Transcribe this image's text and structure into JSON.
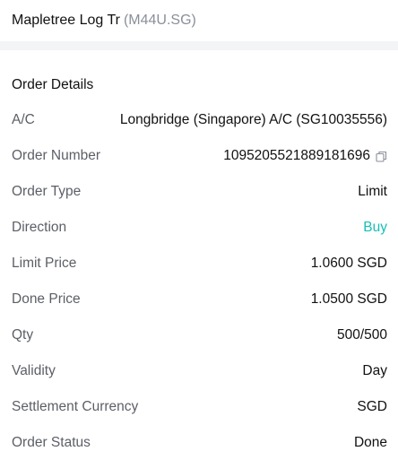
{
  "header": {
    "name": "Mapletree Log Tr",
    "code": "(M44U.SG)"
  },
  "section_title": "Order Details",
  "rows": [
    {
      "label": "A/C",
      "value": "Longbridge (Singapore) A/C (SG10035556)"
    },
    {
      "label": "Order Number",
      "value": "1095205521889181696"
    },
    {
      "label": "Order Type",
      "value": "Limit"
    },
    {
      "label": "Direction",
      "value": "Buy"
    },
    {
      "label": "Limit Price",
      "value": "1.0600 SGD"
    },
    {
      "label": "Done Price",
      "value": "1.0500 SGD"
    },
    {
      "label": "Qty",
      "value": "500/500"
    },
    {
      "label": "Validity",
      "value": "Day"
    },
    {
      "label": "Settlement Currency",
      "value": "SGD"
    },
    {
      "label": "Order Status",
      "value": "Done"
    }
  ],
  "colors": {
    "buy": "#17bfb6",
    "divider": "#f3f4f6",
    "label": "#5c5f66"
  },
  "icons": {
    "copy": "copy-icon"
  }
}
